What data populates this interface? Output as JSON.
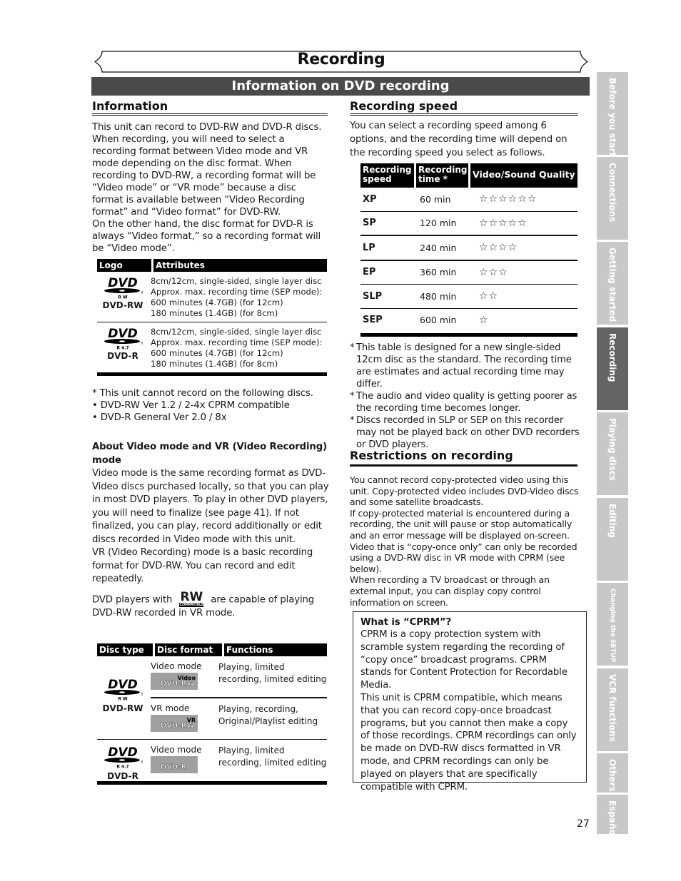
{
  "header": {
    "title": "Recording",
    "subtitle": "Information on DVD recording"
  },
  "side_tabs": [
    {
      "label": "Before you start",
      "active": false
    },
    {
      "label": "Connections",
      "active": false
    },
    {
      "label": "Getting started",
      "active": false
    },
    {
      "label": "Recording",
      "active": true
    },
    {
      "label": "Playing discs",
      "active": false
    },
    {
      "label": "Editing",
      "active": false
    },
    {
      "label": "Changing the SETUP menu",
      "active": false
    },
    {
      "label": "VCR functions",
      "active": false
    },
    {
      "label": "Others",
      "active": false
    },
    {
      "label": "Español",
      "active": false
    }
  ],
  "information": {
    "heading": "Information",
    "paragraph1": "This unit can record to DVD-RW and DVD-R discs. When recording, you will need to select a recording format between Video mode and VR mode depending on the disc format. When recording to DVD-RW, a recording format will be “Video mode” or “VR mode” because a disc format is available between “Video Recording format” and “Video format” for DVD-RW.",
    "paragraph2": "On the other hand, the disc format for DVD-R is always “Video format,” so a recording format will be “Video mode”.",
    "logo_table": {
      "headers": [
        "Logo",
        "Attributes"
      ],
      "rows": [
        {
          "logo_sub": "R W",
          "caption": "DVD-RW",
          "lines": [
            "8cm/12cm, single-sided, single layer disc",
            "Approx. max. recording time (SEP mode):",
            "600 minutes (4.7GB) (for 12cm)",
            "180 minutes (1.4GB) (for 8cm)"
          ]
        },
        {
          "logo_sub": "R 4.7",
          "caption": "DVD-R",
          "lines": [
            "8cm/12cm, single-sided, single layer disc",
            "Approx. max. recording time (SEP mode):",
            "600 minutes (4.7GB) (for 12cm)",
            "180 minutes (1.4GB) (for 8cm)"
          ]
        }
      ]
    },
    "note": "This unit cannot record on the following discs.",
    "bullets": [
      "DVD-RW Ver 1.2 / 2-4x CPRM compatible",
      "DVD-R General Ver 2.0 / 8x"
    ],
    "about_heading": "About Video mode and VR (Video Recording) mode",
    "about_p1": "Video mode is the same recording format as DVD-Video discs purchased locally, so that you can play in most DVD players. To play in other DVD players, you will need to finalize (see page 41). If not finalized, you can play, record additionally or edit discs recorded in Video mode with this unit.",
    "about_p2": "VR (Video Recording) mode is a basic recording format for DVD-RW. You can record and edit repeatedly.",
    "rw_line_before": "DVD players with",
    "rw_logo": {
      "big": "RW",
      "small": "COMPATIBLE"
    },
    "rw_line_after": "are capable of playing DVD-RW recorded in VR mode.",
    "disc_table": {
      "headers": [
        "Disc type",
        "Disc format",
        "Functions"
      ],
      "rows": [
        {
          "disc": "DVD-RW",
          "logo_sub": "R W",
          "formats": [
            {
              "mode": "Video mode",
              "badge_top": "Video",
              "badge_main": "DVD-RW",
              "functions": "Playing, limited recording, limited editing"
            },
            {
              "mode": "VR mode",
              "badge_top": "VR",
              "badge_main": "DVD-RW",
              "functions": "Playing, recording, Original/Playlist editing"
            }
          ]
        },
        {
          "disc": "DVD-R",
          "logo_sub": "R 4.7",
          "formats": [
            {
              "mode": "Video mode",
              "badge_top": "",
              "badge_main": "DVD-R",
              "functions": "Playing, limited recording, limited editing"
            }
          ]
        }
      ]
    }
  },
  "recording_speed": {
    "heading": "Recording speed",
    "intro": "You can select a recording speed among 6 options, and the recording time will depend on the recording speed you select as follows.",
    "headers": [
      "Recording speed",
      "Recording time *",
      "Video/Sound Quality"
    ],
    "rows": [
      {
        "speed": "XP",
        "time": "60 min",
        "quality_stars": 6
      },
      {
        "speed": "SP",
        "time": "120 min",
        "quality_stars": 5
      },
      {
        "speed": "LP",
        "time": "240 min",
        "quality_stars": 4
      },
      {
        "speed": "EP",
        "time": "360 min",
        "quality_stars": 3
      },
      {
        "speed": "SLP",
        "time": "480 min",
        "quality_stars": 2
      },
      {
        "speed": "SEP",
        "time": "600 min",
        "quality_stars": 1
      }
    ],
    "star_glyph": "☆",
    "notes": [
      "This table is designed for a new single-sided 12cm disc as the standard. The recording time are estimates and actual recording time may differ.",
      "The audio and video quality is getting poorer as the recording time becomes longer.",
      "Discs recorded in SLP or SEP on this recorder may not be played back on other DVD recorders or DVD players."
    ]
  },
  "restrictions": {
    "heading": "Restrictions on recording",
    "paragraphs": [
      "You cannot record copy-protected video using this unit. Copy-protected video includes DVD-Video discs and some satellite broadcasts.",
      "If copy-protected material is encountered during a recording, the unit will pause or stop automatically and an error message will be displayed on-screen.",
      "Video that is “copy-once only” can only be recorded using a DVD-RW disc in VR mode with CPRM (see below).",
      "When recording a TV broadcast or through an external input, you can display copy control information on screen."
    ],
    "cprm": {
      "heading": "What is “CPRM”?",
      "paragraphs": [
        "CPRM is a copy protection system with scramble system regarding the recording of “copy once” broadcast programs. CPRM stands for Content Protection for Recordable Media.",
        "This unit is CPRM compatible, which means that you can  record copy-once broadcast programs, but you cannot then make a copy of those recordings. CPRM recordings can only be made on DVD-RW discs formatted in VR mode, and CPRM recordings can only be played on players that are specifically compatible with CPRM."
      ]
    }
  },
  "footer": {
    "page_number": "27"
  },
  "colors": {
    "subtitle_bar": "#4a4a4a",
    "side_tab": "#c8c8c8",
    "side_tab_active": "#646464",
    "table_header": "#000000"
  }
}
